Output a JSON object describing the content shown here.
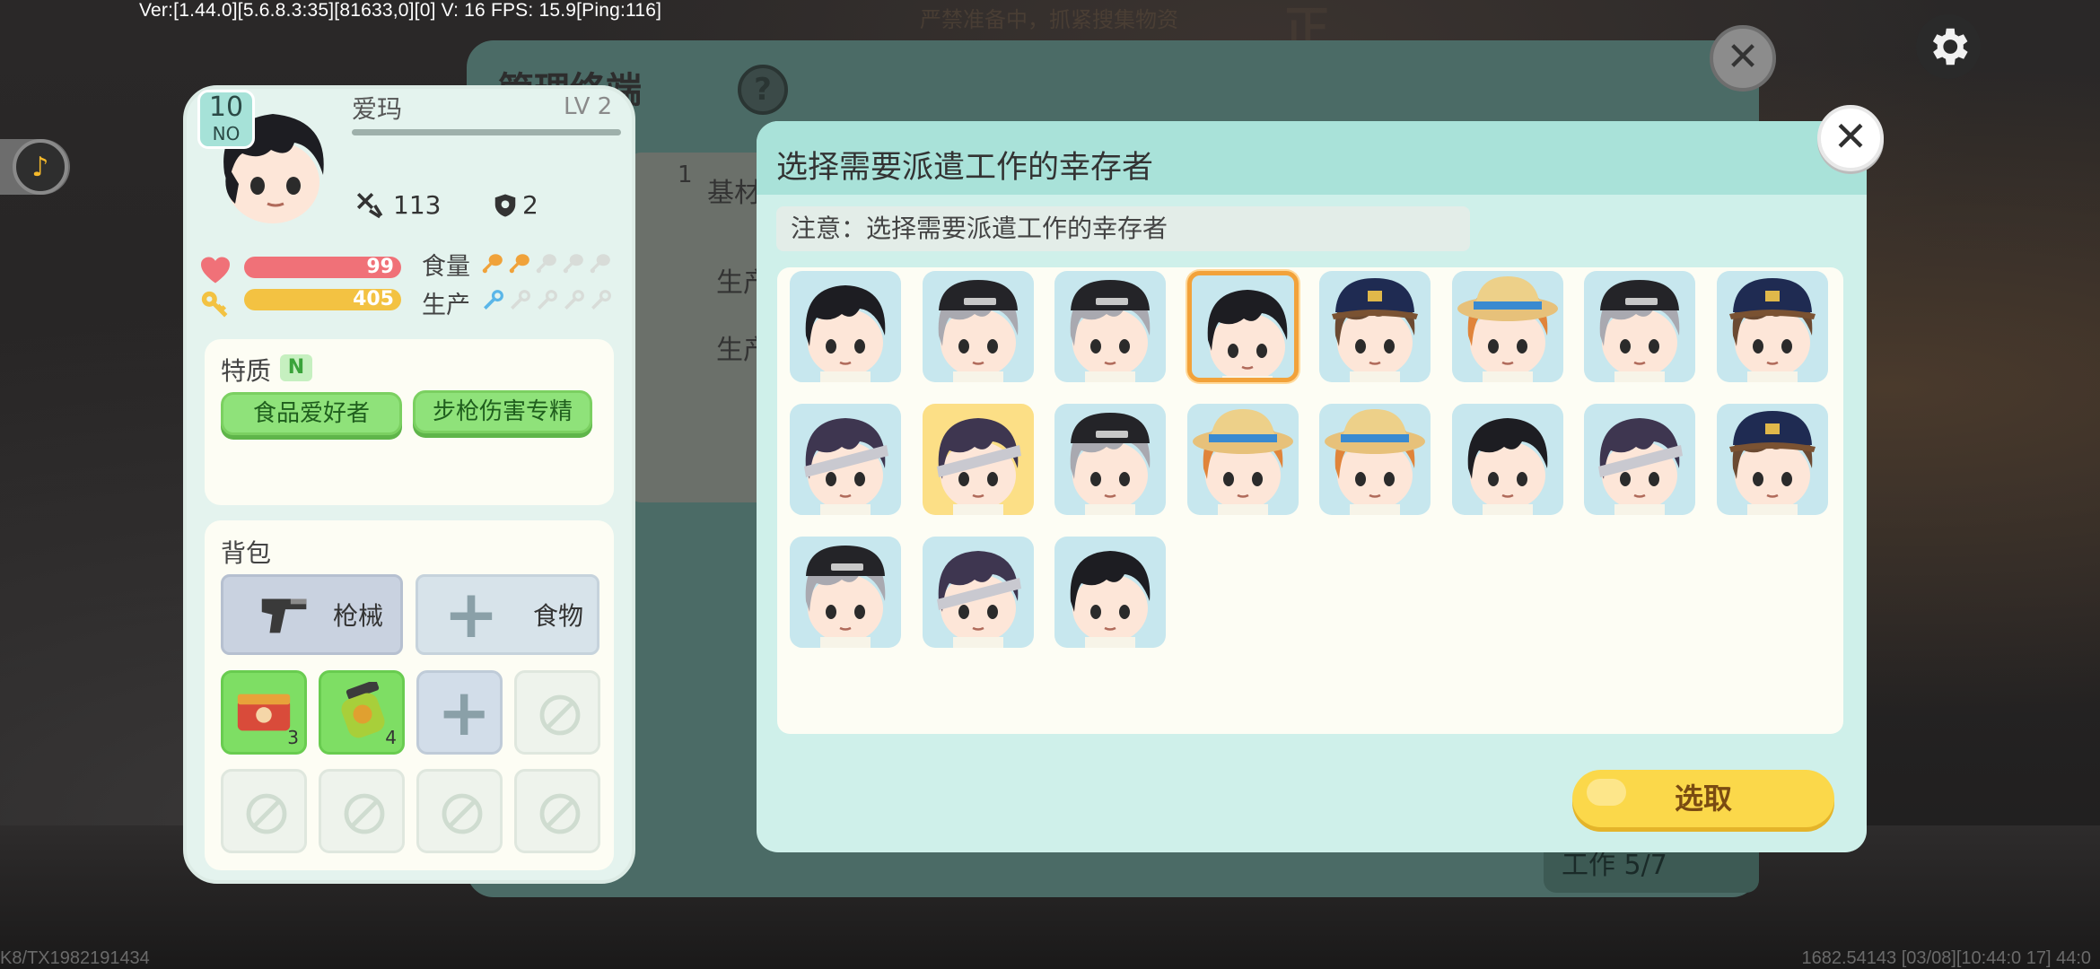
{
  "debug": {
    "top": "Ver:[1.44.0][5.6.8.3:35][81633,0][0] V: 16 FPS: 15.9[Ping:116]",
    "bottom_left": "K8/TX1982191434",
    "bottom_right": "1682.54143   [03/08][10:44:0   17] 44:0"
  },
  "background": {
    "notice": "严禁准备中，抓紧搜集物资",
    "big_title": "正",
    "mgmt_title": "管理终端",
    "mgmt_help": "?",
    "mgmt_close": "✕",
    "tab_num": "1",
    "tab_label": "基材",
    "row1": "生产",
    "row2": "生产",
    "work_label": "工作 5/7"
  },
  "character": {
    "level_num": "10",
    "level_no": "NO",
    "name": "爱玛",
    "lv": "LV 2",
    "attack": "113",
    "defense": "2",
    "hp": "99",
    "energy": "405",
    "food_label": "食量",
    "prod_label": "生产",
    "food_level": 2,
    "prod_level": 1,
    "trait_title": "特质",
    "trait_rank": "N",
    "traits": [
      "食品爱好者",
      "步枪伤害专精"
    ],
    "bag_title": "背包",
    "weapon_label": "枪械",
    "food_slot_label": "食物",
    "bag_item1_count": "3",
    "bag_item2_count": "4"
  },
  "modal": {
    "title": "选择需要派遣工作的幸存者",
    "note": "注意：选择需要派遣工作的幸存者",
    "close": "✕",
    "confirm_label": "选取",
    "survivors": [
      {
        "hair": "black",
        "hat": "none",
        "bg": "blue",
        "selected": false
      },
      {
        "hair": "gray",
        "hat": "cap-black",
        "bg": "blue",
        "selected": false
      },
      {
        "hair": "gray",
        "hat": "cap-black",
        "bg": "blue",
        "selected": false
      },
      {
        "hair": "black",
        "hat": "none",
        "bg": "blue",
        "selected": true
      },
      {
        "hair": "brown",
        "hat": "cap-navy",
        "bg": "blue",
        "selected": false
      },
      {
        "hair": "orange",
        "hat": "straw",
        "bg": "blue",
        "selected": false
      },
      {
        "hair": "gray",
        "hat": "cap-black",
        "bg": "blue",
        "selected": false
      },
      {
        "hair": "brown",
        "hat": "cap-navy",
        "bg": "blue",
        "selected": false
      },
      {
        "hair": "purple",
        "hat": "bandage",
        "bg": "blue",
        "selected": false
      },
      {
        "hair": "purple",
        "hat": "bandage",
        "bg": "yellow",
        "selected": false
      },
      {
        "hair": "gray",
        "hat": "cap-black",
        "bg": "blue",
        "selected": false
      },
      {
        "hair": "orange",
        "hat": "straw",
        "bg": "blue",
        "selected": false
      },
      {
        "hair": "orange",
        "hat": "straw",
        "bg": "blue",
        "selected": false
      },
      {
        "hair": "black",
        "hat": "none",
        "bg": "blue",
        "selected": false
      },
      {
        "hair": "purple",
        "hat": "bandage",
        "bg": "blue",
        "selected": false
      },
      {
        "hair": "brown",
        "hat": "cap-navy",
        "bg": "blue",
        "selected": false
      },
      {
        "hair": "gray",
        "hat": "cap-black",
        "bg": "blue",
        "selected": false
      },
      {
        "hair": "purple",
        "hat": "bandage",
        "bg": "blue",
        "selected": false
      },
      {
        "hair": "black",
        "hat": "none",
        "bg": "blue",
        "selected": false
      }
    ]
  },
  "colors": {
    "hp": "#f07178",
    "energy": "#f3c242",
    "accent_teal": "#a9e2d9",
    "selected_border": "#f2a23a",
    "confirm": "#fbd84a"
  },
  "icons": {
    "music": "music-note-icon",
    "settings": "gear-icon",
    "attack": "crossed-swords-icon",
    "defense": "shield-icon",
    "hp": "heart-icon",
    "energy": "key-icon"
  }
}
